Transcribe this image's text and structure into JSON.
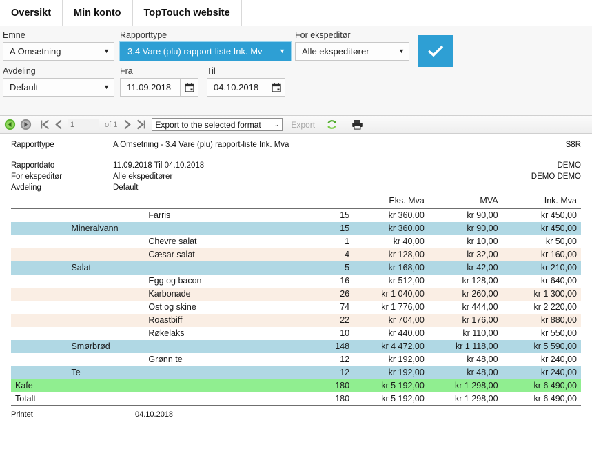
{
  "tabs": [
    {
      "label": "Oversikt",
      "name": "tab-oversikt"
    },
    {
      "label": "Min konto",
      "name": "tab-min-konto"
    },
    {
      "label": "TopTouch website",
      "name": "tab-toptouch-website"
    }
  ],
  "accent_color": "#2e9fd4",
  "filters": {
    "emne": {
      "label": "Emne",
      "value": "A Omsetning"
    },
    "rapporttype": {
      "label": "Rapporttype",
      "value": "3.4 Vare (plu) rapport-liste Ink. Mv",
      "focused": true
    },
    "ekspeditor": {
      "label": "For ekspeditør",
      "value": "Alle ekspeditører"
    },
    "avdeling": {
      "label": "Avdeling",
      "value": "Default"
    },
    "fra": {
      "label": "Fra",
      "value": "11.09.2018"
    },
    "til": {
      "label": "Til",
      "value": "04.10.2018"
    },
    "submit": {
      "label": "",
      "icon": "check-icon"
    }
  },
  "toolbar": {
    "back_icon": "back-arrow-icon",
    "forward_icon": "forward-arrow-icon",
    "first_page_icon": "first-page-icon",
    "prev_page_icon": "prev-page-icon",
    "next_page_icon": "next-page-icon",
    "last_page_icon": "last-page-icon",
    "page_number": "1",
    "of_text": "of 1",
    "export_format": "Export to the selected format",
    "export_label": "Export",
    "refresh_icon": "refresh-icon",
    "print_icon": "print-icon"
  },
  "report_header": {
    "rows": [
      {
        "label": "Rapporttype",
        "value": "A Omsetning - 3.4 Vare (plu) rapport-liste Ink. Mva",
        "right": "S8R"
      },
      {
        "label": "Rapportdato",
        "value": "11.09.2018 Til 04.10.2018",
        "right": "DEMO"
      },
      {
        "label": "For ekspeditør",
        "value": "Alle ekspeditører",
        "right": "DEMO DEMO"
      },
      {
        "label": "Avdeling",
        "value": "Default",
        "right": ""
      }
    ]
  },
  "table": {
    "headers": {
      "eks_mva": "Eks. Mva",
      "mva": "MVA",
      "ink_mva": "Ink. Mva"
    },
    "rows": [
      {
        "type": "item",
        "group": "",
        "sub": "",
        "item": "Farris",
        "qty": "15",
        "eks": "kr 360,00",
        "mva": "kr 90,00",
        "ink": "kr 450,00"
      },
      {
        "type": "sub",
        "group": "",
        "sub": "Mineralvann",
        "item": "",
        "qty": "15",
        "eks": "kr 360,00",
        "mva": "kr 90,00",
        "ink": "kr 450,00"
      },
      {
        "type": "item",
        "group": "",
        "sub": "",
        "item": "Chevre salat",
        "qty": "1",
        "eks": "kr 40,00",
        "mva": "kr 10,00",
        "ink": "kr 50,00"
      },
      {
        "type": "tint",
        "group": "",
        "sub": "",
        "item": "Cæsar salat",
        "qty": "4",
        "eks": "kr 128,00",
        "mva": "kr 32,00",
        "ink": "kr 160,00"
      },
      {
        "type": "sub",
        "group": "",
        "sub": "Salat",
        "item": "",
        "qty": "5",
        "eks": "kr 168,00",
        "mva": "kr 42,00",
        "ink": "kr 210,00"
      },
      {
        "type": "item",
        "group": "",
        "sub": "",
        "item": "Egg og bacon",
        "qty": "16",
        "eks": "kr 512,00",
        "mva": "kr 128,00",
        "ink": "kr 640,00"
      },
      {
        "type": "tint",
        "group": "",
        "sub": "",
        "item": "Karbonade",
        "qty": "26",
        "eks": "kr 1 040,00",
        "mva": "kr 260,00",
        "ink": "kr 1 300,00"
      },
      {
        "type": "item",
        "group": "",
        "sub": "",
        "item": "Ost og skine",
        "qty": "74",
        "eks": "kr 1 776,00",
        "mva": "kr 444,00",
        "ink": "kr 2 220,00"
      },
      {
        "type": "tint",
        "group": "",
        "sub": "",
        "item": "Roastbiff",
        "qty": "22",
        "eks": "kr 704,00",
        "mva": "kr 176,00",
        "ink": "kr 880,00"
      },
      {
        "type": "item",
        "group": "",
        "sub": "",
        "item": "Røkelaks",
        "qty": "10",
        "eks": "kr 440,00",
        "mva": "kr 110,00",
        "ink": "kr 550,00"
      },
      {
        "type": "sub",
        "group": "",
        "sub": "Smørbrød",
        "item": "",
        "qty": "148",
        "eks": "kr 4 472,00",
        "mva": "kr 1 118,00",
        "ink": "kr 5 590,00"
      },
      {
        "type": "item",
        "group": "",
        "sub": "",
        "item": "Grønn te",
        "qty": "12",
        "eks": "kr 192,00",
        "mva": "kr 48,00",
        "ink": "kr 240,00"
      },
      {
        "type": "sub",
        "group": "",
        "sub": "Te",
        "item": "",
        "qty": "12",
        "eks": "kr 192,00",
        "mva": "kr 48,00",
        "ink": "kr 240,00"
      },
      {
        "type": "grand",
        "group": "Kafe",
        "sub": "",
        "item": "",
        "qty": "180",
        "eks": "kr 5 192,00",
        "mva": "kr 1 298,00",
        "ink": "kr 6 490,00"
      },
      {
        "type": "total",
        "group": "Totalt",
        "sub": "",
        "item": "",
        "qty": "180",
        "eks": "kr 5 192,00",
        "mva": "kr 1 298,00",
        "ink": "kr 6 490,00"
      }
    ]
  },
  "footer": {
    "label": "Printet",
    "value": "04.10.2018"
  }
}
